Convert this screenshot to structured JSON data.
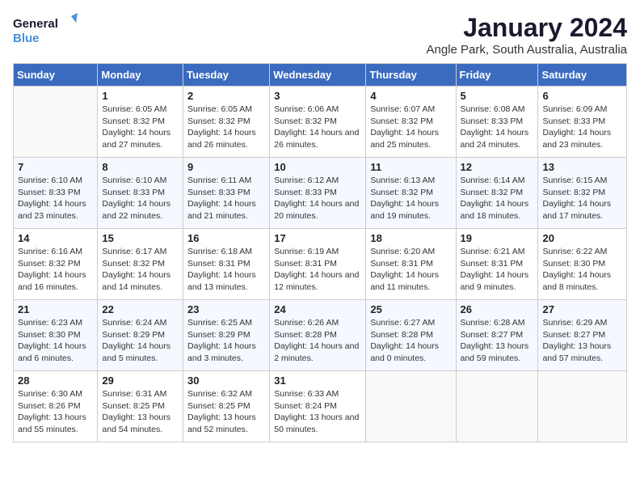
{
  "header": {
    "logo_line1": "General",
    "logo_line2": "Blue",
    "month": "January 2024",
    "location": "Angle Park, South Australia, Australia"
  },
  "weekdays": [
    "Sunday",
    "Monday",
    "Tuesday",
    "Wednesday",
    "Thursday",
    "Friday",
    "Saturday"
  ],
  "weeks": [
    [
      {
        "day": "",
        "sunrise": "",
        "sunset": "",
        "daylight": ""
      },
      {
        "day": "1",
        "sunrise": "Sunrise: 6:05 AM",
        "sunset": "Sunset: 8:32 PM",
        "daylight": "Daylight: 14 hours and 27 minutes."
      },
      {
        "day": "2",
        "sunrise": "Sunrise: 6:05 AM",
        "sunset": "Sunset: 8:32 PM",
        "daylight": "Daylight: 14 hours and 26 minutes."
      },
      {
        "day": "3",
        "sunrise": "Sunrise: 6:06 AM",
        "sunset": "Sunset: 8:32 PM",
        "daylight": "Daylight: 14 hours and 26 minutes."
      },
      {
        "day": "4",
        "sunrise": "Sunrise: 6:07 AM",
        "sunset": "Sunset: 8:32 PM",
        "daylight": "Daylight: 14 hours and 25 minutes."
      },
      {
        "day": "5",
        "sunrise": "Sunrise: 6:08 AM",
        "sunset": "Sunset: 8:33 PM",
        "daylight": "Daylight: 14 hours and 24 minutes."
      },
      {
        "day": "6",
        "sunrise": "Sunrise: 6:09 AM",
        "sunset": "Sunset: 8:33 PM",
        "daylight": "Daylight: 14 hours and 23 minutes."
      }
    ],
    [
      {
        "day": "7",
        "sunrise": "Sunrise: 6:10 AM",
        "sunset": "Sunset: 8:33 PM",
        "daylight": "Daylight: 14 hours and 23 minutes."
      },
      {
        "day": "8",
        "sunrise": "Sunrise: 6:10 AM",
        "sunset": "Sunset: 8:33 PM",
        "daylight": "Daylight: 14 hours and 22 minutes."
      },
      {
        "day": "9",
        "sunrise": "Sunrise: 6:11 AM",
        "sunset": "Sunset: 8:33 PM",
        "daylight": "Daylight: 14 hours and 21 minutes."
      },
      {
        "day": "10",
        "sunrise": "Sunrise: 6:12 AM",
        "sunset": "Sunset: 8:33 PM",
        "daylight": "Daylight: 14 hours and 20 minutes."
      },
      {
        "day": "11",
        "sunrise": "Sunrise: 6:13 AM",
        "sunset": "Sunset: 8:32 PM",
        "daylight": "Daylight: 14 hours and 19 minutes."
      },
      {
        "day": "12",
        "sunrise": "Sunrise: 6:14 AM",
        "sunset": "Sunset: 8:32 PM",
        "daylight": "Daylight: 14 hours and 18 minutes."
      },
      {
        "day": "13",
        "sunrise": "Sunrise: 6:15 AM",
        "sunset": "Sunset: 8:32 PM",
        "daylight": "Daylight: 14 hours and 17 minutes."
      }
    ],
    [
      {
        "day": "14",
        "sunrise": "Sunrise: 6:16 AM",
        "sunset": "Sunset: 8:32 PM",
        "daylight": "Daylight: 14 hours and 16 minutes."
      },
      {
        "day": "15",
        "sunrise": "Sunrise: 6:17 AM",
        "sunset": "Sunset: 8:32 PM",
        "daylight": "Daylight: 14 hours and 14 minutes."
      },
      {
        "day": "16",
        "sunrise": "Sunrise: 6:18 AM",
        "sunset": "Sunset: 8:31 PM",
        "daylight": "Daylight: 14 hours and 13 minutes."
      },
      {
        "day": "17",
        "sunrise": "Sunrise: 6:19 AM",
        "sunset": "Sunset: 8:31 PM",
        "daylight": "Daylight: 14 hours and 12 minutes."
      },
      {
        "day": "18",
        "sunrise": "Sunrise: 6:20 AM",
        "sunset": "Sunset: 8:31 PM",
        "daylight": "Daylight: 14 hours and 11 minutes."
      },
      {
        "day": "19",
        "sunrise": "Sunrise: 6:21 AM",
        "sunset": "Sunset: 8:31 PM",
        "daylight": "Daylight: 14 hours and 9 minutes."
      },
      {
        "day": "20",
        "sunrise": "Sunrise: 6:22 AM",
        "sunset": "Sunset: 8:30 PM",
        "daylight": "Daylight: 14 hours and 8 minutes."
      }
    ],
    [
      {
        "day": "21",
        "sunrise": "Sunrise: 6:23 AM",
        "sunset": "Sunset: 8:30 PM",
        "daylight": "Daylight: 14 hours and 6 minutes."
      },
      {
        "day": "22",
        "sunrise": "Sunrise: 6:24 AM",
        "sunset": "Sunset: 8:29 PM",
        "daylight": "Daylight: 14 hours and 5 minutes."
      },
      {
        "day": "23",
        "sunrise": "Sunrise: 6:25 AM",
        "sunset": "Sunset: 8:29 PM",
        "daylight": "Daylight: 14 hours and 3 minutes."
      },
      {
        "day": "24",
        "sunrise": "Sunrise: 6:26 AM",
        "sunset": "Sunset: 8:28 PM",
        "daylight": "Daylight: 14 hours and 2 minutes."
      },
      {
        "day": "25",
        "sunrise": "Sunrise: 6:27 AM",
        "sunset": "Sunset: 8:28 PM",
        "daylight": "Daylight: 14 hours and 0 minutes."
      },
      {
        "day": "26",
        "sunrise": "Sunrise: 6:28 AM",
        "sunset": "Sunset: 8:27 PM",
        "daylight": "Daylight: 13 hours and 59 minutes."
      },
      {
        "day": "27",
        "sunrise": "Sunrise: 6:29 AM",
        "sunset": "Sunset: 8:27 PM",
        "daylight": "Daylight: 13 hours and 57 minutes."
      }
    ],
    [
      {
        "day": "28",
        "sunrise": "Sunrise: 6:30 AM",
        "sunset": "Sunset: 8:26 PM",
        "daylight": "Daylight: 13 hours and 55 minutes."
      },
      {
        "day": "29",
        "sunrise": "Sunrise: 6:31 AM",
        "sunset": "Sunset: 8:25 PM",
        "daylight": "Daylight: 13 hours and 54 minutes."
      },
      {
        "day": "30",
        "sunrise": "Sunrise: 6:32 AM",
        "sunset": "Sunset: 8:25 PM",
        "daylight": "Daylight: 13 hours and 52 minutes."
      },
      {
        "day": "31",
        "sunrise": "Sunrise: 6:33 AM",
        "sunset": "Sunset: 8:24 PM",
        "daylight": "Daylight: 13 hours and 50 minutes."
      },
      {
        "day": "",
        "sunrise": "",
        "sunset": "",
        "daylight": ""
      },
      {
        "day": "",
        "sunrise": "",
        "sunset": "",
        "daylight": ""
      },
      {
        "day": "",
        "sunrise": "",
        "sunset": "",
        "daylight": ""
      }
    ]
  ]
}
